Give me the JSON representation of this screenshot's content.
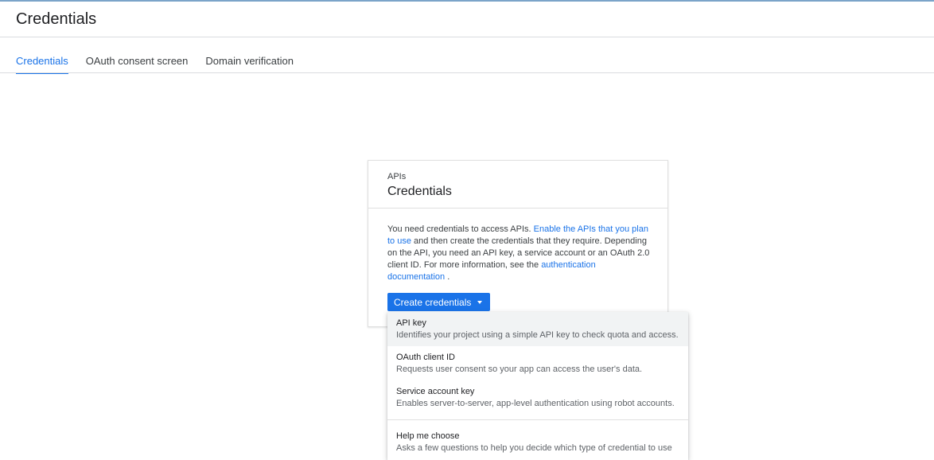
{
  "header": {
    "title": "Credentials"
  },
  "tabs": [
    {
      "label": "Credentials",
      "active": true
    },
    {
      "label": "OAuth consent screen",
      "active": false
    },
    {
      "label": "Domain verification",
      "active": false
    }
  ],
  "card": {
    "overline": "APIs",
    "title": "Credentials",
    "body": {
      "text_1": "You need credentials to access APIs. ",
      "link_1": "Enable the APIs that you plan to use",
      "text_2": " and then create the credentials that they require. Depending on the API, you need an API key, a service account or an OAuth 2.0 client ID. For more information, see the ",
      "link_2": "authentication documentation",
      "text_3": " ."
    },
    "button_label": "Create credentials"
  },
  "menu": {
    "items": [
      {
        "title": "API key",
        "description": "Identifies your project using a simple API key to check quota and access."
      },
      {
        "title": "OAuth client ID",
        "description": "Requests user consent so your app can access the user's data."
      },
      {
        "title": "Service account key",
        "description": "Enables server-to-server, app-level authentication using robot accounts."
      },
      {
        "title": "Help me choose",
        "description": "Asks a few questions to help you decide which type of credential to use"
      }
    ]
  },
  "colors": {
    "accent": "#1a73e8",
    "highlight": "#f1f3f4"
  }
}
